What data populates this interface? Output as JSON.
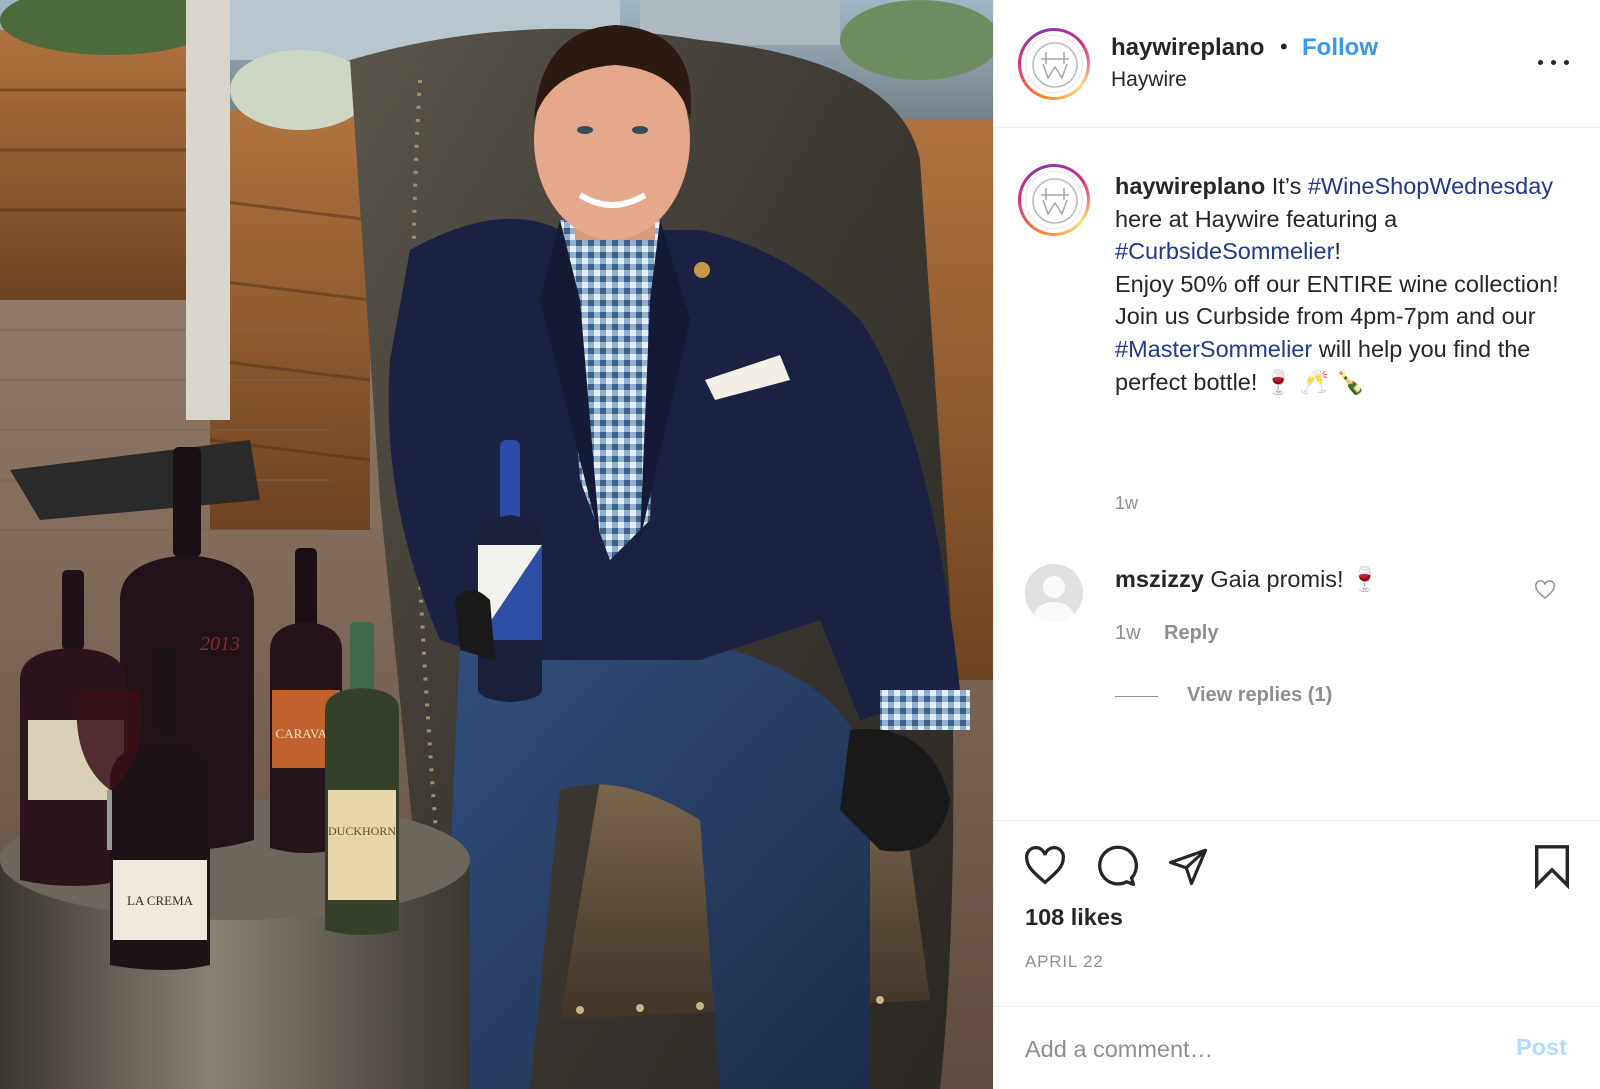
{
  "post": {
    "author": {
      "username": "haywireplano",
      "separator": "•",
      "follow_label": "Follow",
      "subtitle": "Haywire"
    },
    "caption": {
      "username": "haywireplano",
      "segments": [
        {
          "text": " It’s ",
          "type": "text"
        },
        {
          "text": "#WineShopWednesday",
          "type": "hashtag"
        },
        {
          "text": " here at Haywire featuring a ",
          "type": "text"
        },
        {
          "text": "#CurbsideSommelier",
          "type": "hashtag"
        },
        {
          "text": "!",
          "type": "text"
        },
        {
          "text": "Enjoy 50% off our ENTIRE wine collection!",
          "type": "line"
        },
        {
          "text": "Join us Curbside from 4pm-7pm and our ",
          "type": "line"
        },
        {
          "text": "#MasterSommelier",
          "type": "hashtag"
        },
        {
          "text": " will help you find the perfect bottle! 🍷 🥂 🍾",
          "type": "text"
        }
      ],
      "time": "1w"
    },
    "comments": [
      {
        "username": "mszizzy",
        "text": " Gaia promis! 🍷",
        "time": "1w",
        "reply_label": "Reply",
        "view_replies_label": "View replies (1)"
      }
    ],
    "likes": "108 likes",
    "date": "APRIL 22",
    "add_comment": {
      "placeholder": "Add a comment…",
      "post_label": "Post"
    },
    "photo": {
      "labels": {
        "la_crema": "LA CREMA",
        "duckhorn": "DUCKHORN",
        "caravan": "CARAVAN",
        "bottle_year": "2013"
      }
    }
  },
  "colors": {
    "link": "#3897f0",
    "hashtag": "#1f3a8a",
    "muted": "#8e8e8e",
    "post_disabled": "#b3dbff"
  }
}
